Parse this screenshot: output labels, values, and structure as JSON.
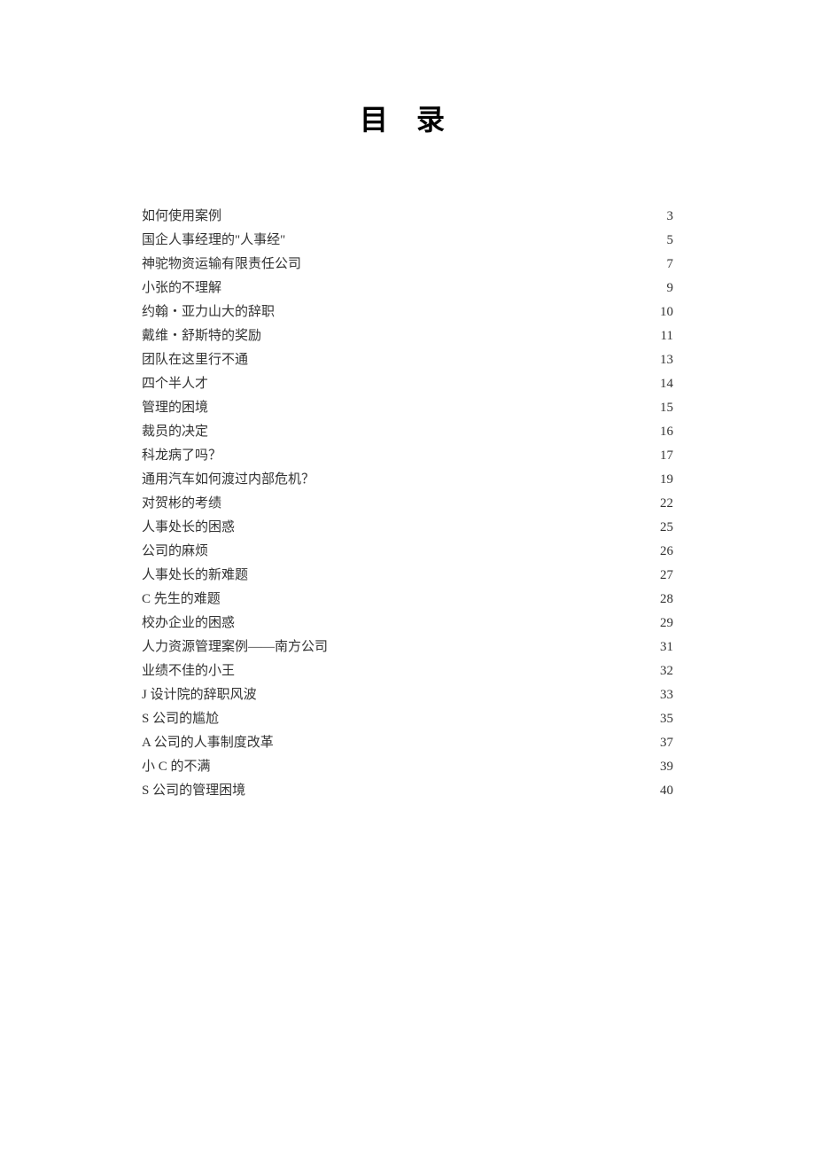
{
  "title": "目 录",
  "entries": [
    {
      "label": "如何使用案例",
      "page": "3"
    },
    {
      "label": "国企人事经理的\"人事经\"",
      "page": "5"
    },
    {
      "label": "神驼物资运输有限责任公司",
      "page": "7"
    },
    {
      "label": "小张的不理解",
      "page": "9"
    },
    {
      "label": "约翰・亚力山大的辞职",
      "page": "10"
    },
    {
      "label": "戴维・舒斯特的奖励",
      "page": "11"
    },
    {
      "label": "团队在这里行不通",
      "page": "13"
    },
    {
      "label": "四个半人才",
      "page": "14"
    },
    {
      "label": "管理的困境",
      "page": "15"
    },
    {
      "label": "裁员的决定",
      "page": "16"
    },
    {
      "label": "科龙病了吗？",
      "page": "17"
    },
    {
      "label": "通用汽车如何渡过内部危机？",
      "page": "19"
    },
    {
      "label": "对贺彬的考绩",
      "page": "22"
    },
    {
      "label": "人事处长的困惑",
      "page": "25"
    },
    {
      "label": "公司的麻烦",
      "page": "26"
    },
    {
      "label": "人事处长的新难题",
      "page": "27"
    },
    {
      "label": "C 先生的难题",
      "page": "28"
    },
    {
      "label": "校办企业的困惑",
      "page": "29"
    },
    {
      "label": "人力资源管理案例——南方公司",
      "page": "31"
    },
    {
      "label": "业绩不佳的小王",
      "page": "32"
    },
    {
      "label": "J 设计院的辞职风波",
      "page": "33"
    },
    {
      "label": "S 公司的尴尬",
      "page": "35"
    },
    {
      "label": "A 公司的人事制度改革",
      "page": "37"
    },
    {
      "label": "小 C 的不满",
      "page": "39"
    },
    {
      "label": "S 公司的管理困境",
      "page": "40"
    }
  ]
}
